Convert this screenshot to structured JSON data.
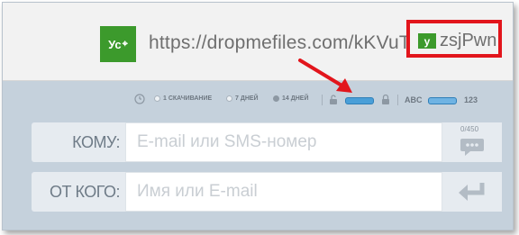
{
  "url_bar": {
    "copy_button_label": "Ус",
    "url": "https://dropmefiles.com/kKVuT",
    "highlight_button_label": "у",
    "url_tail": "zsjPwn"
  },
  "options": {
    "download_1": "1 СКАЧИВАНИЕ",
    "days_7": "7 ДНЕЙ",
    "days_14": "14 ДНЕЙ",
    "selected": "14 ДНЕЙ",
    "abc_label": "ABC",
    "num_label": "123"
  },
  "to_field": {
    "label": "КОМУ:",
    "placeholder": "E-mail или SMS-номер",
    "counter": "0/450"
  },
  "from_field": {
    "label": "ОТ КОГО:",
    "placeholder": "Имя или E-mail"
  },
  "colors": {
    "accent_green": "#3c9a2c",
    "highlight_red": "#e2151c",
    "toggle_blue": "#4a9fd8"
  }
}
